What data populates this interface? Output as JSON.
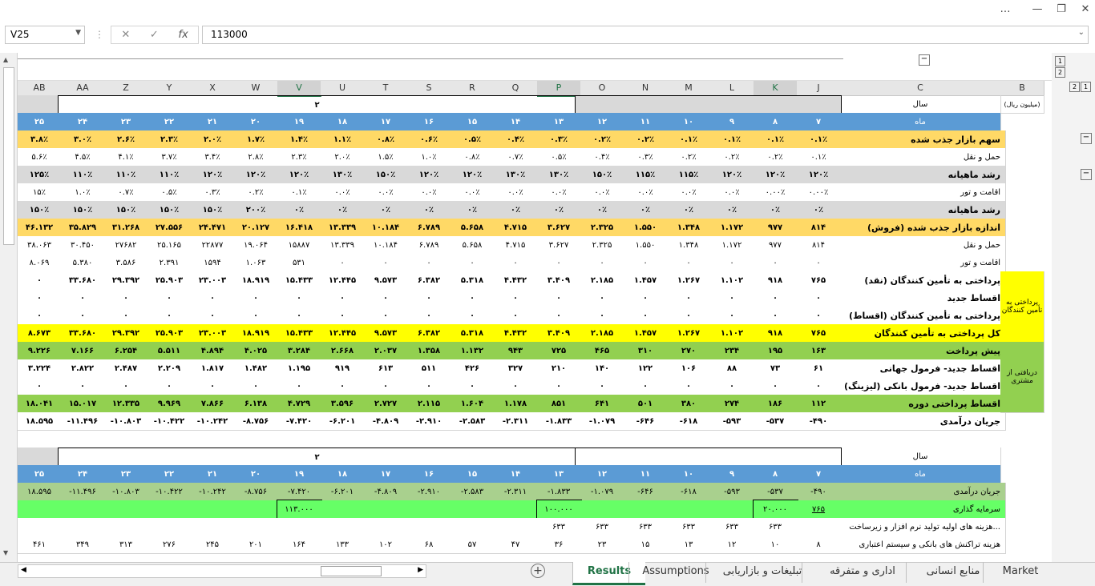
{
  "window": {
    "buttons": [
      "…",
      "—",
      "❐",
      "✕"
    ]
  },
  "formula_bar": {
    "cell_ref": "V25",
    "value": "113000",
    "cancel_icon": "✕",
    "enter_icon": "✓",
    "fx_label": "fx"
  },
  "column_headers": [
    "AB",
    "AA",
    "Z",
    "Y",
    "X",
    "W",
    "V",
    "U",
    "T",
    "S",
    "R",
    "Q",
    "P",
    "O",
    "N",
    "M",
    "L",
    "K",
    "J",
    "C",
    "B"
  ],
  "selected_columns": [
    "V",
    "P",
    "K"
  ],
  "row_numbers": [
    "2",
    "3",
    "4",
    "5",
    "6",
    "7",
    "8",
    "9",
    "10",
    "11",
    "12",
    "13",
    "14",
    "15",
    "16",
    "17",
    "18",
    "19",
    "20",
    "21",
    "22",
    "23",
    "24",
    "25",
    "26",
    "27"
  ],
  "selected_row": "25",
  "sheet": {
    "unit_label": "(میلیون ریال)",
    "year_label": "سال",
    "year_value": "۲",
    "month_label": "ماه",
    "months": [
      "۲۵",
      "۲۴",
      "۲۳",
      "۲۲",
      "۲۱",
      "۲۰",
      "۱۹",
      "۱۸",
      "۱۷",
      "۱۶",
      "۱۵",
      "۱۴",
      "۱۳",
      "۱۲",
      "۱۱",
      "۱۰",
      "۹",
      "۸",
      "۷"
    ],
    "rows": [
      {
        "label": "سهم بازار جذب شده",
        "style": "orange",
        "values": [
          "۳.۸٪",
          "۳.۰٪",
          "۲.۶٪",
          "۲.۳٪",
          "۲.۰٪",
          "۱.۷٪",
          "۱.۴٪",
          "۱.۱٪",
          "۰.۸٪",
          "۰.۶٪",
          "۰.۵٪",
          "۰.۴٪",
          "۰.۳٪",
          "۰.۲٪",
          "۰.۲٪",
          "۰.۱٪",
          "۰.۱٪",
          "۰.۱٪",
          "۰.۱٪"
        ]
      },
      {
        "label": "حمل و نقل",
        "style": "plain",
        "values": [
          "۵.۶٪",
          "۴.۵٪",
          "۴.۱٪",
          "۳.۷٪",
          "۳.۴٪",
          "۲.۸٪",
          "۲.۳٪",
          "۲.۰٪",
          "۱.۵٪",
          "۱.۰٪",
          "۰.۸٪",
          "۰.۷٪",
          "۰.۵٪",
          "۰.۴٪",
          "۰.۳٪",
          "۰.۲٪",
          "۰.۲٪",
          "۰.۲٪",
          "۰.۱٪"
        ]
      },
      {
        "label": "رشد ماهیانه",
        "style": "gray",
        "values": [
          "۱۲۵٪",
          "۱۱۰٪",
          "۱۱۰٪",
          "۱۱۰٪",
          "۱۲۰٪",
          "۱۲۰٪",
          "۱۲۰٪",
          "۱۳۰٪",
          "۱۵۰٪",
          "۱۲۰٪",
          "۱۲۰٪",
          "۱۳۰٪",
          "۱۳۰٪",
          "۱۵۰٪",
          "۱۱۵٪",
          "۱۱۵٪",
          "۱۲۰٪",
          "۱۲۰٪",
          "۱۲۰٪"
        ]
      },
      {
        "label": "اقامت و تور",
        "style": "plain",
        "values": [
          "۱۵٪",
          "۱.۰٪",
          "۰.۷٪",
          "۰.۵٪",
          "۰.۳٪",
          "۰.۲٪",
          "۰.۱٪",
          "۰.۰٪",
          "۰.۰٪",
          "۰.۰٪",
          "۰.۰٪",
          "۰.۰٪",
          "۰.۰٪",
          "۰.۰٪",
          "۰.۰٪",
          "۰.۰٪",
          "۰.۰٪",
          "۰.۰۰٪",
          "۰.۰۰٪"
        ]
      },
      {
        "label": "رشد ماهیانه",
        "style": "gray",
        "values": [
          "۱۵۰٪",
          "۱۵۰٪",
          "۱۵۰٪",
          "۱۵۰٪",
          "۱۵۰٪",
          "۲۰۰٪",
          "۰٪",
          "۰٪",
          "۰٪",
          "۰٪",
          "۰٪",
          "۰٪",
          "۰٪",
          "۰٪",
          "۰٪",
          "۰٪",
          "۰٪",
          "۰٪",
          "۰٪"
        ]
      },
      {
        "label": "اندازه بازار جذب شده (فروش)",
        "style": "orange",
        "values": [
          "۴۶.۱۳۲",
          "۳۵.۸۲۹",
          "۳۱.۲۶۸",
          "۲۷.۵۵۶",
          "۲۴.۴۷۱",
          "۲۰.۱۲۷",
          "۱۶.۴۱۸",
          "۱۳.۳۳۹",
          "۱۰.۱۸۴",
          "۶.۷۸۹",
          "۵.۶۵۸",
          "۴.۷۱۵",
          "۳.۶۲۷",
          "۲.۳۲۵",
          "۱.۵۵۰",
          "۱.۳۴۸",
          "۱.۱۷۲",
          "۹۷۷",
          "۸۱۴"
        ]
      },
      {
        "label": "حمل و نقل",
        "style": "plain",
        "values": [
          "۳۸.۰۶۳",
          "۳۰.۴۵۰",
          "۲۷۶۸۲",
          "۲۵.۱۶۵",
          "۲۲۸۷۷",
          "۱۹.۰۶۴",
          "۱۵۸۸۷",
          "۱۳.۳۳۹",
          "۱۰.۱۸۴",
          "۶.۷۸۹",
          "۵.۶۵۸",
          "۴.۷۱۵",
          "۳.۶۲۷",
          "۲.۳۲۵",
          "۱.۵۵۰",
          "۱.۳۴۸",
          "۱.۱۷۲",
          "۹۷۷",
          "۸۱۴"
        ]
      },
      {
        "label": "اقامت و تور",
        "style": "plain",
        "values": [
          "۸.۰۶۹",
          "۵.۳۸۰",
          "۳.۵۸۶",
          "۲.۳۹۱",
          "۱۵۹۴",
          "۱.۰۶۳",
          "۵۳۱",
          "۰",
          "۰",
          "۰",
          "۰",
          "۰",
          "۰",
          "۰",
          "۰",
          "۰",
          "۰",
          "۰",
          "۰"
        ]
      },
      {
        "label": "پرداختی به تأمین کنندگان (نقد)",
        "style": "boldplain",
        "values": [
          "۰",
          "۳۳.۶۸۰",
          "۲۹.۳۹۲",
          "۲۵.۹۰۳",
          "۲۳.۰۰۳",
          "۱۸.۹۱۹",
          "۱۵.۴۳۳",
          "۱۲.۴۴۵",
          "۹.۵۷۳",
          "۶.۳۸۲",
          "۵.۳۱۸",
          "۴.۴۳۲",
          "۳.۴۰۹",
          "۲.۱۸۵",
          "۱.۴۵۷",
          "۱.۲۶۷",
          "۱.۱۰۲",
          "۹۱۸",
          "۷۶۵"
        ]
      },
      {
        "label": "اقساط جدید",
        "style": "boldplain",
        "values": [
          "۰",
          "۰",
          "۰",
          "۰",
          "۰",
          "۰",
          "۰",
          "۰",
          "۰",
          "۰",
          "۰",
          "۰",
          "۰",
          "۰",
          "۰",
          "۰",
          "۰",
          "۰",
          "۰"
        ]
      },
      {
        "label": "پرداختی به تأمین کنندگان (اقساط)",
        "style": "boldplain",
        "values": [
          "۰",
          "۰",
          "۰",
          "۰",
          "۰",
          "۰",
          "۰",
          "۰",
          "۰",
          "۰",
          "۰",
          "۰",
          "۰",
          "۰",
          "۰",
          "۰",
          "۰",
          "۰",
          "۰"
        ]
      },
      {
        "label": "کل پرداختی به تأمین کنندگان",
        "style": "yellow",
        "values": [
          "۸.۶۷۳",
          "۳۳.۶۸۰",
          "۲۹.۳۹۲",
          "۲۵.۹۰۳",
          "۲۳.۰۰۳",
          "۱۸.۹۱۹",
          "۱۵.۴۳۳",
          "۱۲.۴۴۵",
          "۹.۵۷۳",
          "۶.۳۸۲",
          "۵.۳۱۸",
          "۴.۴۳۲",
          "۳.۴۰۹",
          "۲.۱۸۵",
          "۱.۴۵۷",
          "۱.۲۶۷",
          "۱.۱۰۲",
          "۹۱۸",
          "۷۶۵"
        ]
      },
      {
        "label": "پیش پرداخت",
        "style": "green",
        "values": [
          "۹.۲۲۶",
          "۷.۱۶۶",
          "۶.۲۵۴",
          "۵.۵۱۱",
          "۴.۸۹۴",
          "۴.۰۲۵",
          "۳.۲۸۴",
          "۲.۶۶۸",
          "۲.۰۳۷",
          "۱.۳۵۸",
          "۱.۱۳۲",
          "۹۴۳",
          "۷۲۵",
          "۴۶۵",
          "۳۱۰",
          "۲۷۰",
          "۲۳۴",
          "۱۹۵",
          "۱۶۳"
        ]
      },
      {
        "label": "اقساط جدید- فرمول جهانی",
        "style": "boldplain",
        "values": [
          "۳.۲۲۴",
          "۲.۸۲۲",
          "۲.۴۸۷",
          "۲.۲۰۹",
          "۱.۸۱۷",
          "۱.۴۸۲",
          "۱.۱۹۵",
          "۹۱۹",
          "۶۱۳",
          "۵۱۱",
          "۴۲۶",
          "۳۲۷",
          "۲۱۰",
          "۱۴۰",
          "۱۲۲",
          "۱۰۶",
          "۸۸",
          "۷۳",
          "۶۱"
        ]
      },
      {
        "label": "اقساط جدید- فرمول بانکی (لیزینگ)",
        "style": "boldplain",
        "values": [
          "۰",
          "۰",
          "۰",
          "۰",
          "۰",
          "۰",
          "۰",
          "۰",
          "۰",
          "۰",
          "۰",
          "۰",
          "۰",
          "۰",
          "۰",
          "۰",
          "۰",
          "۰",
          "۰"
        ]
      },
      {
        "label": "اقساط پرداختی دوره",
        "style": "green",
        "values": [
          "۱۸.۰۴۱",
          "۱۵.۰۱۷",
          "۱۲.۳۳۵",
          "۹.۹۶۹",
          "۷.۸۶۶",
          "۶.۱۳۸",
          "۴.۷۲۹",
          "۳.۵۹۶",
          "۲.۷۲۷",
          "۲.۱۱۵",
          "۱.۶۰۴",
          "۱.۱۷۸",
          "۸۵۱",
          "۶۴۱",
          "۵۰۱",
          "۳۸۰",
          "۲۷۴",
          "۱۸۶",
          "۱۱۲"
        ]
      },
      {
        "label": "جریان درآمدی",
        "style": "boldplain",
        "values": [
          "۱۸.۵۹۵",
          "-۱۱.۴۹۶",
          "-۱۰.۸۰۳",
          "-۱۰.۴۲۲",
          "-۱۰.۲۴۲",
          "-۸.۷۵۶",
          "-۷.۴۲۰",
          "-۶.۲۰۱",
          "-۴.۸۰۹",
          "-۲.۹۱۰",
          "-۲.۵۸۳",
          "-۲.۳۱۱",
          "-۱.۸۳۳",
          "-۱.۰۷۹",
          "-۶۴۶",
          "-۶۱۸",
          "-۵۹۳",
          "-۵۳۷",
          "-۴۹۰"
        ]
      }
    ],
    "side_labels": {
      "suppliers": "پرداختی به تأمین کنندگان",
      "customers": "دریافتی از مشتری"
    },
    "section2": {
      "rows": [
        {
          "label": "جریان درآمدی",
          "style": "lightgreen",
          "values": [
            "۱۸.۵۹۵",
            "-۱۱.۴۹۶",
            "-۱۰.۸۰۳",
            "-۱۰.۴۲۲",
            "-۱۰.۲۴۲",
            "-۸.۷۵۶",
            "-۷.۴۲۰",
            "-۶.۲۰۱",
            "-۴.۸۰۹",
            "-۲.۹۱۰",
            "-۲.۵۸۳",
            "-۲.۳۱۱",
            "-۱.۸۳۳",
            "-۱.۰۷۹",
            "-۶۴۶",
            "-۶۱۸",
            "-۵۹۳",
            "-۵۳۷",
            "-۴۹۰"
          ]
        },
        {
          "label": "سرمایه گذاری",
          "style": "brightgreen",
          "values": [
            "",
            "",
            "",
            "",
            "",
            "",
            "۱۱۳.۰۰۰",
            "",
            "",
            "",
            "",
            "",
            "۱۰۰.۰۰۰",
            "",
            "",
            "",
            "",
            "۲۰.۰۰۰",
            "۷۶۵"
          ]
        },
        {
          "label": "هزینه های اولیه تولید نرم افزار و زیرساخت...",
          "style": "plainsmall",
          "values": [
            "",
            "",
            "",
            "",
            "",
            "",
            "",
            "",
            "",
            "",
            "",
            "",
            "۶۳۳",
            "۶۳۳",
            "۶۳۳",
            "۶۳۳",
            "۶۳۳",
            "۶۳۳",
            ""
          ]
        },
        {
          "label": "هزینه تراکنش های بانکی و سیستم اعتباری",
          "style": "plainsmall",
          "values": [
            "۴۶۱",
            "۳۴۹",
            "۳۱۳",
            "۲۷۶",
            "۲۴۵",
            "۲۰۱",
            "۱۶۴",
            "۱۳۳",
            "۱۰۲",
            "۶۸",
            "۵۷",
            "۴۷",
            "۳۶",
            "۲۳",
            "۱۵",
            "۱۳",
            "۱۲",
            "۱۰",
            "۸"
          ]
        }
      ]
    }
  },
  "tabs": [
    "Market",
    "منابع انسانی",
    "اداری و متفرقه",
    "تبلیغات و بازاریابی",
    "Assumptions",
    "Results"
  ],
  "active_tab": "Results",
  "colors": {
    "blue": "#5b9bd5",
    "orange": "#ffd966",
    "gray": "#d9d9d9",
    "yellow": "#ffff00",
    "green": "#92d050",
    "brightgreen": "#66ff66",
    "lightgreen": "#a9d08e",
    "accent": "#217346"
  }
}
